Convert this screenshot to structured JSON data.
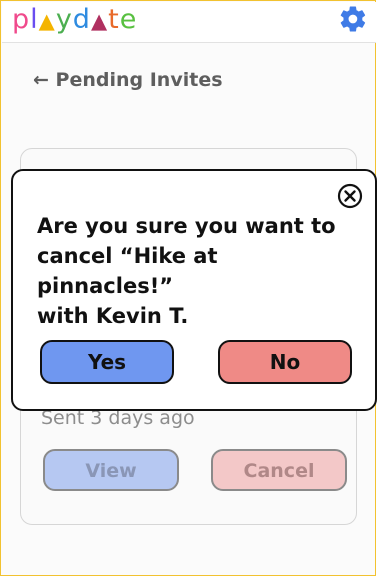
{
  "brand": {
    "letters": [
      "p",
      "l",
      "▲",
      "y",
      "d",
      "▲",
      "t",
      "e"
    ]
  },
  "header": {
    "settings_icon": "gear-icon"
  },
  "nav": {
    "back_arrow": "←",
    "title": "Pending Invites"
  },
  "invite": {
    "sent_text": "Sent 3 days ago",
    "view_label": "View",
    "cancel_label": "Cancel"
  },
  "modal": {
    "close_icon": "close-circle-icon",
    "message_line1": "Are you sure you want to",
    "message_line2": "cancel “Hike at pinnacles!”",
    "message_line3": "with Kevin T.",
    "yes_label": "Yes",
    "no_label": "No"
  },
  "colors": {
    "yes_button": "#6f97f0",
    "no_button": "#ef8a86",
    "view_button": "#b6c8f2",
    "cancel_button": "#f3c8c8",
    "frame_border": "#f2c230"
  }
}
